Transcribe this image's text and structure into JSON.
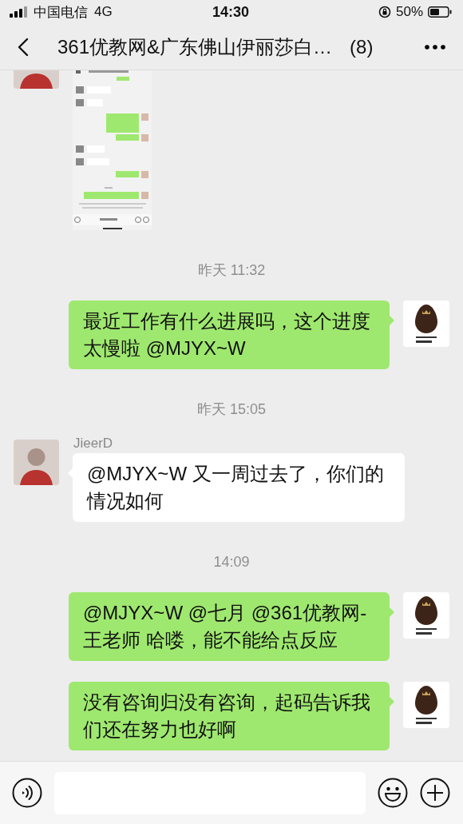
{
  "status_bar": {
    "carrier": "中国电信",
    "network": "4G",
    "time": "14:30",
    "battery": "50%"
  },
  "nav_bar": {
    "title": "361优教网&广东佛山伊丽莎白…",
    "member_count": "(8)"
  },
  "messages": [
    {
      "kind": "received_image"
    },
    {
      "kind": "time",
      "text": "昨天 11:32"
    },
    {
      "kind": "sent_text",
      "text": "最近工作有什么进展吗，这个进度太慢啦 @MJYX~W"
    },
    {
      "kind": "time",
      "text": "昨天 15:05"
    },
    {
      "kind": "received_text",
      "sender": "JieerD",
      "text": "@MJYX~W 又一周过去了，你们的情况如何"
    },
    {
      "kind": "time",
      "text": "14:09"
    },
    {
      "kind": "sent_text",
      "text": "@MJYX~W @七月 @361优教网-王老师 哈喽，能不能给点反应"
    },
    {
      "kind": "sent_text",
      "text": "没有咨询归没有咨询，起码告诉我们还在努力也好啊"
    }
  ]
}
